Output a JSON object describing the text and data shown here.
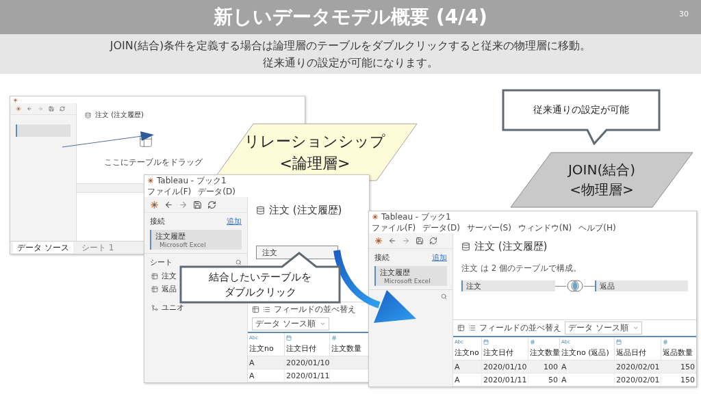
{
  "slide": {
    "title": "新しいデータモデル概要 (4/4)",
    "page_number": "30",
    "subtitle_lines": [
      "JOIN(結合)条件を定義する場合は論理層のテーブルをダブルクリックすると従来の物理層に移動。",
      "従来通りの設定が可能になります。"
    ]
  },
  "left_window": {
    "heading": "注文 (注文履歴)",
    "drop_hint": "ここにテーブルをドラッグ",
    "tabs": [
      {
        "label": "データ ソース",
        "selected": true
      },
      {
        "label": "シート 1",
        "selected": false
      }
    ]
  },
  "logical_window": {
    "title": "Tableau - ブック1",
    "menus": [
      "ファイル(F)",
      "データ(D)"
    ],
    "connections_label": "接続",
    "add_link": "追加",
    "connection": {
      "name": "注文履歴",
      "type": "Microsoft Excel"
    },
    "sheets_label": "シート",
    "sheets": [
      "注文",
      "返品"
    ],
    "union_label": "ユニオ",
    "heading": "注文 (注文履歴)",
    "table_box": "注文",
    "sort_label": "フィールドの並べ替え",
    "sort_value": "データ ソース順",
    "columns": [
      {
        "kind": "string",
        "type_label": "Abc",
        "name": "注文no"
      },
      {
        "kind": "date",
        "name": "注文日付"
      },
      {
        "kind": "number",
        "name": "注文数量"
      }
    ],
    "rows": [
      [
        "A",
        "2020/01/10"
      ],
      [
        "A",
        "2020/01/11"
      ]
    ]
  },
  "physical_window": {
    "title": "Tableau - ブック1",
    "menus": [
      "ファイル(F)",
      "データ(D)",
      "サーバー(S)",
      "ウィンドウ(N)",
      "ヘルプ(H)"
    ],
    "connections_label": "接続",
    "add_link": "追加",
    "connection": {
      "name": "注文履歴",
      "type": "Microsoft Excel"
    },
    "heading": "注文 (注文履歴)",
    "description": "注文 は 2 個のテーブルで構成。",
    "join": {
      "left": "注文",
      "right": "返品"
    },
    "sort_label": "フィールドの並べ替え",
    "sort_value": "データ ソース順",
    "columns": [
      {
        "kind": "string",
        "type_label": "Abc",
        "name": "注文no"
      },
      {
        "kind": "date",
        "name": "注文日付"
      },
      {
        "kind": "number",
        "name": "注文数量"
      },
      {
        "kind": "string",
        "type_label": "Abc",
        "name": "注文no (返品)"
      },
      {
        "kind": "date",
        "name": "返品日付"
      },
      {
        "kind": "number",
        "name": "返品数量"
      }
    ],
    "rows": [
      [
        "A",
        "2020/01/10",
        "100",
        "A",
        "2020/02/01",
        "150"
      ],
      [
        "A",
        "2020/01/11",
        "50",
        "A",
        "2020/02/01",
        "150"
      ]
    ]
  },
  "callouts": [
    {
      "kind": "parallelogram-light",
      "lines": [
        "リレーションシップ",
        "<論理層>"
      ]
    },
    {
      "kind": "speech-up",
      "lines": [
        "結合したいテーブルを",
        "ダブルクリック"
      ]
    },
    {
      "kind": "speech-down",
      "lines": [
        "従来通りの設定が可能"
      ]
    },
    {
      "kind": "parallelogram-dark",
      "lines": [
        "JOIN(結合)",
        "<物理層>"
      ]
    }
  ]
}
